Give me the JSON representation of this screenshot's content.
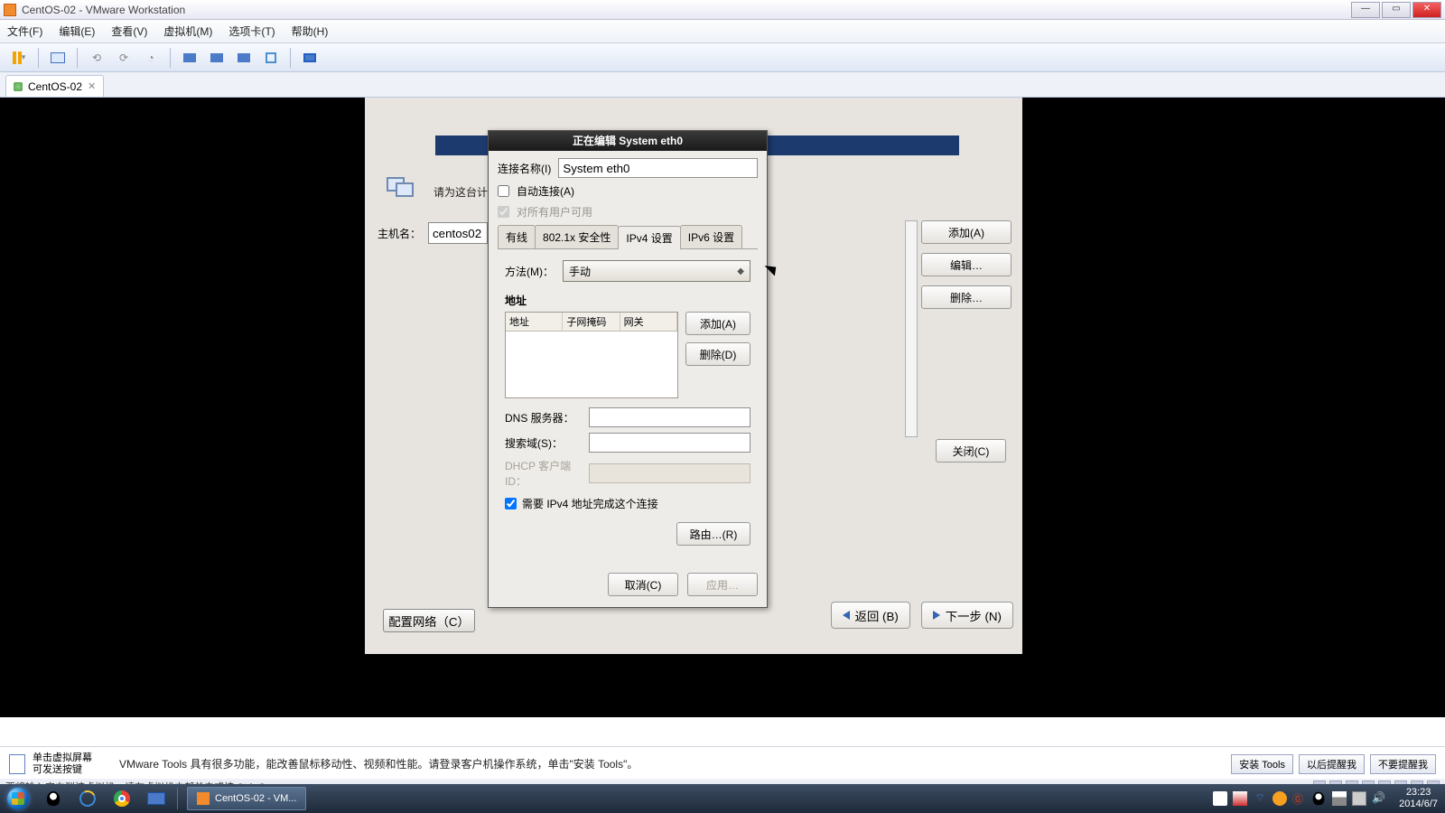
{
  "window": {
    "title": "CentOS-02 - VMware Workstation",
    "min": "—",
    "max": "▭",
    "close": "✕"
  },
  "menu": {
    "file": "文件(F)",
    "edit": "编辑(E)",
    "view": "查看(V)",
    "vm": "虚拟机(M)",
    "tabs": "选项卡(T)",
    "help": "帮助(H)"
  },
  "tab": {
    "name": "CentOS-02",
    "close": "✕"
  },
  "installer": {
    "prompt": "请为这台计",
    "hostname_label": "主机名：",
    "hostname_value": "centos02",
    "cfg_network": "配置网络（C）",
    "right_add": "添加(A)",
    "right_edit": "编辑…",
    "right_delete": "删除…",
    "right_close": "关闭(C)",
    "back": "返回 (B)",
    "next": "下一步 (N)"
  },
  "dialog": {
    "title": "正在编辑 System eth0",
    "conn_label": "连接名称(I)",
    "conn_value": "System eth0",
    "auto_connect": "自动连接(A)",
    "all_users": "对所有用户可用",
    "tabs": {
      "wired": "有线",
      "sec": "802.1x 安全性",
      "ipv4": "IPv4 设置",
      "ipv6": "IPv6 设置"
    },
    "method_label": "方法(M)：",
    "method_value": "手动",
    "addresses_label": "地址",
    "cols": {
      "addr": "地址",
      "mask": "子网掩码",
      "gw": "网关"
    },
    "add_btn": "添加(A)",
    "del_btn": "删除(D)",
    "dns_label": "DNS 服务器：",
    "search_label": "搜索域(S)：",
    "dhcp_label": "DHCP 客户端 ID：",
    "require_ipv4": "需要 IPv4 地址完成这个连接",
    "routes": "路由…(R)",
    "cancel": "取消(C)",
    "apply": "应用…"
  },
  "footer": {
    "hint_title": "单击虚拟屏幕",
    "hint_sub": "可发送按键",
    "tools_msg": "VMware Tools 具有很多功能，能改善鼠标移动性、视频和性能。请登录客户机操作系统，单击\"安装 Tools\"。",
    "install_tools": "安装 Tools",
    "remind_later": "以后提醒我",
    "never_remind": "不要提醒我"
  },
  "statusbar": {
    "msg": "要将输入定向到该虚拟机，请在虚拟机内部单击或按 Ctrl+G。"
  },
  "taskbar": {
    "app": "CentOS-02 - VM..."
  },
  "clock": {
    "time": "23:23",
    "date": "2014/6/7"
  }
}
